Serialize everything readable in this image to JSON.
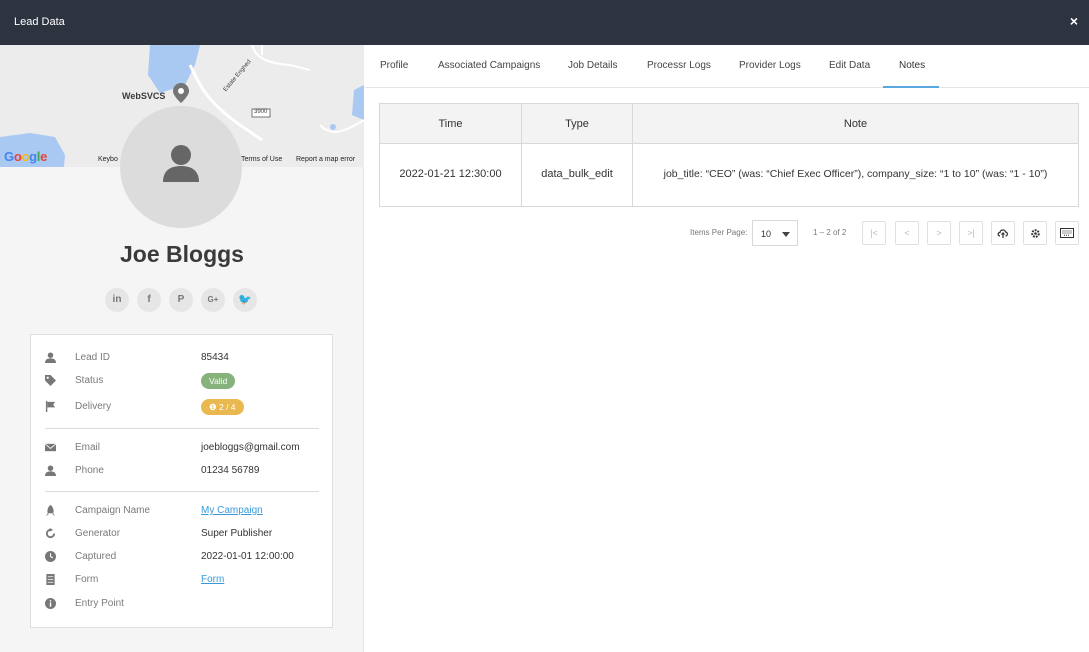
{
  "window": {
    "title": "Lead Data",
    "close_glyph": "×"
  },
  "map": {
    "place_label": "WebSVCS",
    "road_label": "Estate Enghed",
    "route_number": "3900",
    "google_logo": [
      "G",
      "o",
      "o",
      "g",
      "l",
      "e"
    ],
    "google_colors": [
      "#4285F4",
      "#EA4335",
      "#FBBC05",
      "#4285F4",
      "#34A853",
      "#EA4335"
    ],
    "footer": {
      "keyboard": "Keybo",
      "terms": "Terms of Use",
      "report": "Report a map error"
    }
  },
  "profile": {
    "name": "Joe Bloggs"
  },
  "socials": [
    {
      "icon": "linkedin-icon",
      "glyph": "in"
    },
    {
      "icon": "facebook-icon",
      "glyph": "f"
    },
    {
      "icon": "pinterest-icon",
      "glyph": "P"
    },
    {
      "icon": "google-plus-icon",
      "glyph": "G+"
    },
    {
      "icon": "twitter-icon",
      "glyph": "🐦"
    }
  ],
  "details": {
    "lead_id": {
      "label": "Lead ID",
      "value": "85434"
    },
    "status": {
      "label": "Status",
      "value": "Valid",
      "color": "#86b27c"
    },
    "delivery": {
      "label": "Delivery",
      "value": "❶ 2 / 4",
      "color": "#e9b84e"
    },
    "email": {
      "label": "Email",
      "value": "joebloggs@gmail.com"
    },
    "phone": {
      "label": "Phone",
      "value": "01234 56789"
    },
    "campaign_name": {
      "label": "Campaign Name",
      "value": "My Campaign"
    },
    "generator": {
      "label": "Generator",
      "value": "Super Publisher"
    },
    "captured": {
      "label": "Captured",
      "value": "2022-01-01 12:00:00"
    },
    "form": {
      "label": "Form",
      "value": "Form"
    },
    "entry_point": {
      "label": "Entry Point",
      "value": ""
    }
  },
  "tabs": [
    {
      "label": "Profile"
    },
    {
      "label": "Associated Campaigns"
    },
    {
      "label": "Job Details"
    },
    {
      "label": "Processr Logs"
    },
    {
      "label": "Provider Logs"
    },
    {
      "label": "Edit Data"
    },
    {
      "label": "Notes",
      "active": true
    }
  ],
  "accent_color": "#5aa8e0",
  "notes_table": {
    "columns": [
      "Time",
      "Type",
      "Note"
    ],
    "rows": [
      {
        "time": "2022-01-21 12:30:00",
        "type": "data_bulk_edit",
        "note": "job_title: “CEO” (was: “Chief Exec Officer”), company_size: “1 to 10” (was: “1 - 10”)"
      }
    ]
  },
  "pager": {
    "items_per_page_label": "Items Per Page:",
    "items_per_page": "10",
    "range": "1 – 2 of 2",
    "first_glyph": "|<",
    "prev_glyph": "<",
    "next_glyph": ">",
    "last_glyph": ">|"
  }
}
